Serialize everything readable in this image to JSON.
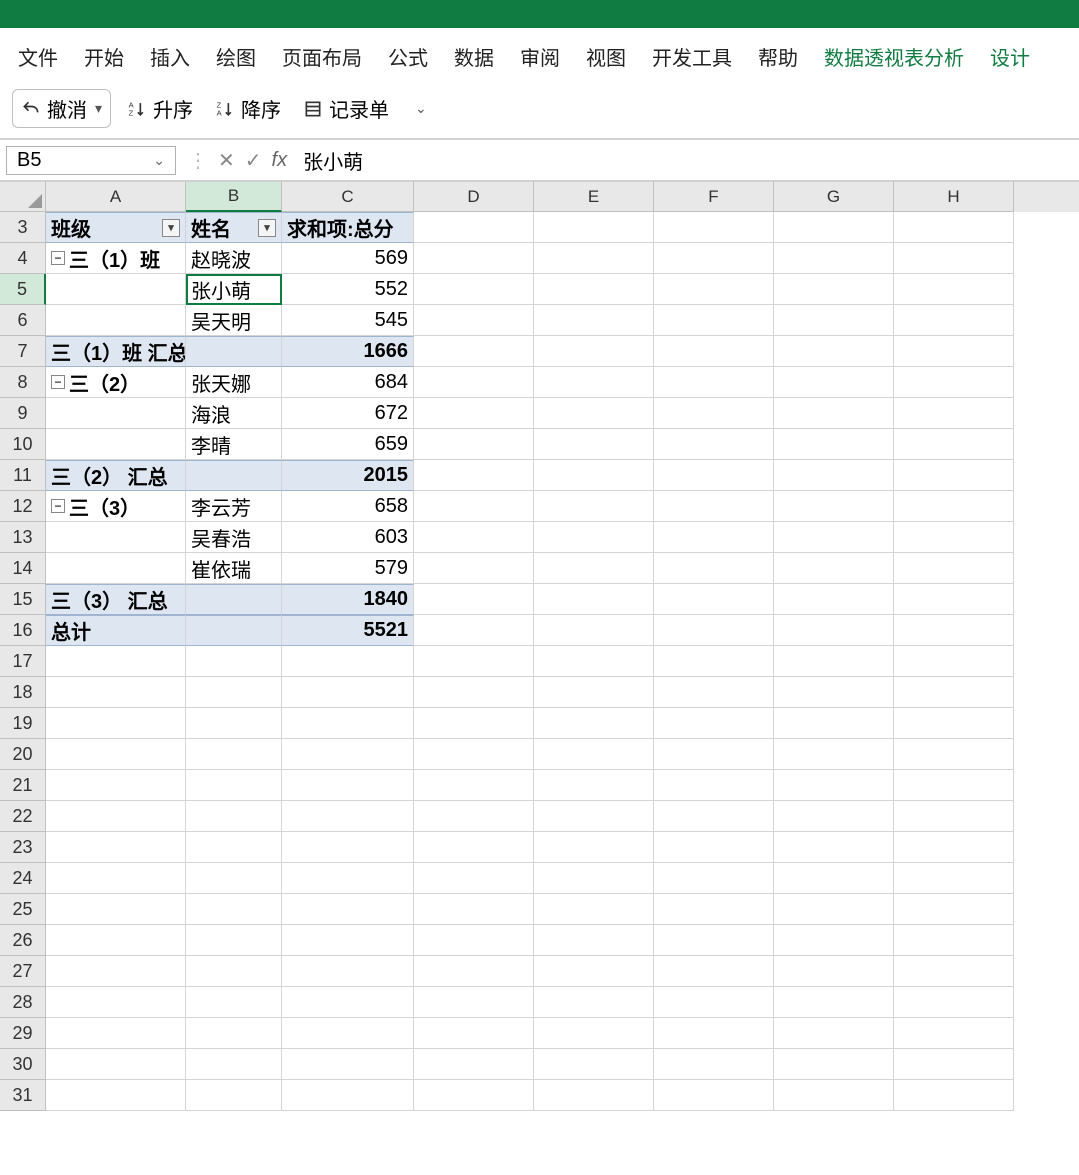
{
  "ribbon": {
    "tabs": [
      "文件",
      "开始",
      "插入",
      "绘图",
      "页面布局",
      "公式",
      "数据",
      "审阅",
      "视图",
      "开发工具",
      "帮助",
      "数据透视表分析",
      "设计"
    ],
    "context_tabs": [
      "数据透视表分析",
      "设计"
    ]
  },
  "toolbar": {
    "undo": "撤消",
    "sort_asc": "升序",
    "sort_desc": "降序",
    "form": "记录单"
  },
  "name_box": "B5",
  "formula_value": "张小萌",
  "columns": [
    "A",
    "B",
    "C",
    "D",
    "E",
    "F",
    "G",
    "H"
  ],
  "active_cell": {
    "row": 5,
    "col": "B"
  },
  "pivot": {
    "headers": {
      "class": "班级",
      "name": "姓名",
      "sum": "求和项:总分"
    },
    "groups": [
      {
        "label": "三（1）班",
        "rows": [
          {
            "name": "赵晓波",
            "score": 569
          },
          {
            "name": "张小萌",
            "score": 552
          },
          {
            "name": "吴天明",
            "score": 545
          }
        ],
        "subtotal_label": "三（1）班 汇总",
        "subtotal": 1666
      },
      {
        "label": "三（2）",
        "rows": [
          {
            "name": "张天娜",
            "score": 684
          },
          {
            "name": "海浪",
            "score": 672
          },
          {
            "name": "李晴",
            "score": 659
          }
        ],
        "subtotal_label": "三（2） 汇总",
        "subtotal": 2015
      },
      {
        "label": "三（3）",
        "rows": [
          {
            "name": "李云芳",
            "score": 658
          },
          {
            "name": "吴春浩",
            "score": 603
          },
          {
            "name": "崔依瑞",
            "score": 579
          }
        ],
        "subtotal_label": "三（3） 汇总",
        "subtotal": 1840
      }
    ],
    "grand_label": "总计",
    "grand_total": 5521
  },
  "row_start": 3,
  "row_end": 31
}
